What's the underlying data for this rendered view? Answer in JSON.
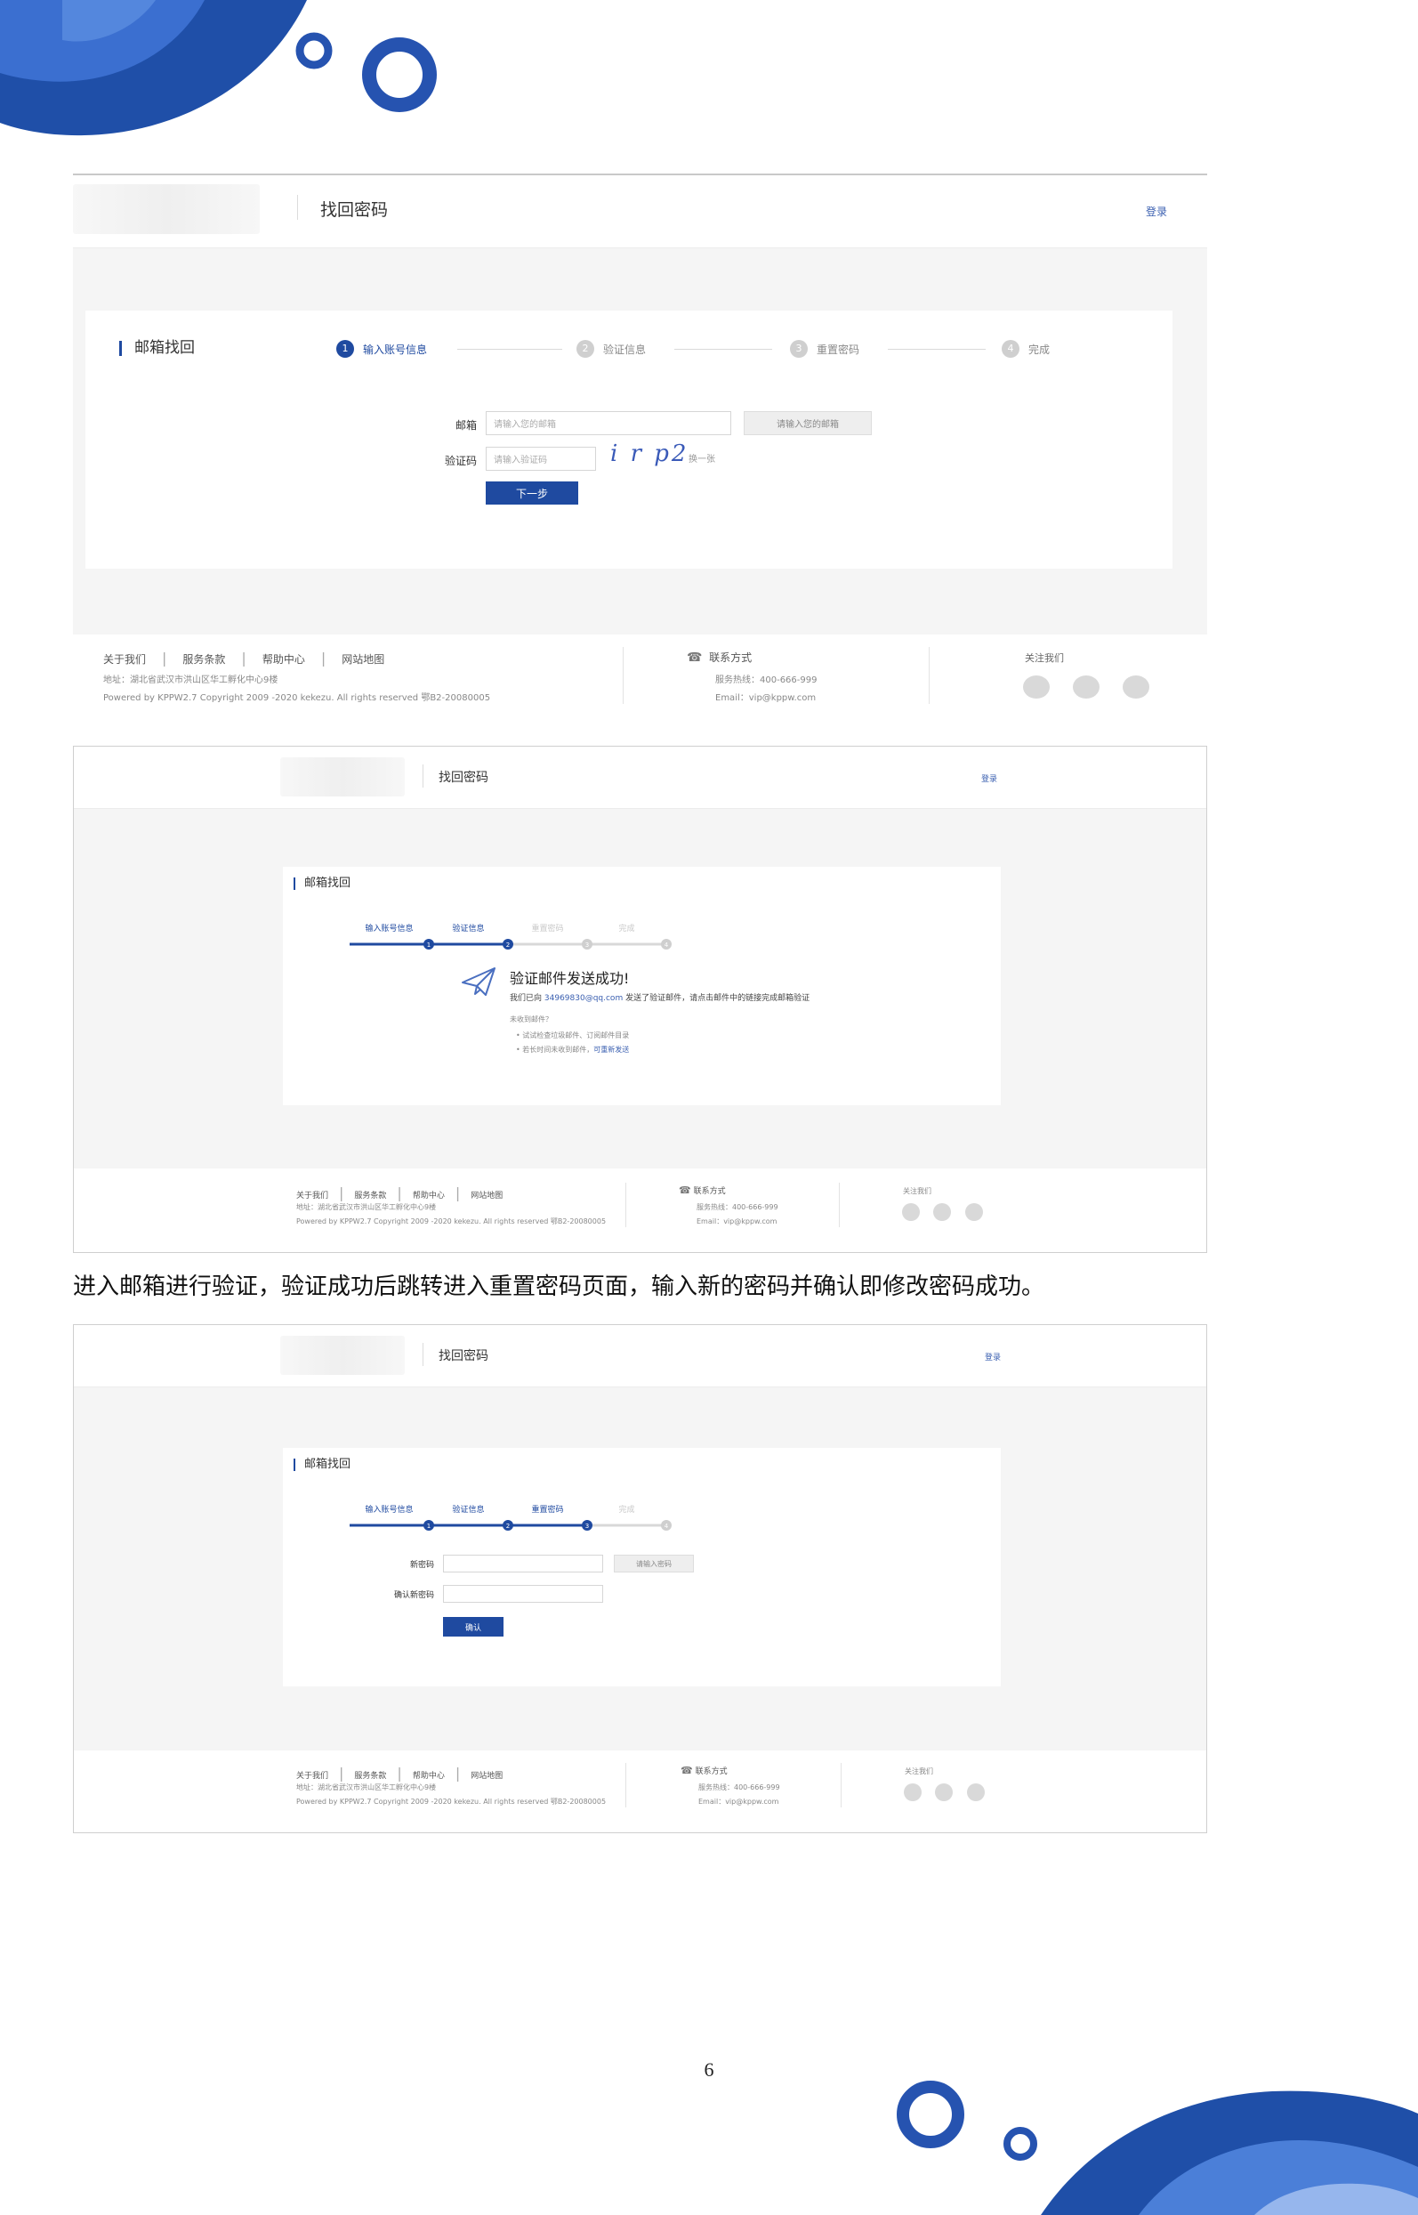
{
  "colors": {
    "brand": "#1f4aa0",
    "link": "#3a5fb0",
    "inactive": "#cfcfcf"
  },
  "shot1": {
    "header": {
      "title": "找回密码",
      "login": "登录"
    },
    "section_title": "邮箱找回",
    "steps": [
      {
        "num": "1",
        "label": "输入账号信息",
        "active": true
      },
      {
        "num": "2",
        "label": "验证信息",
        "active": false
      },
      {
        "num": "3",
        "label": "重置密码",
        "active": false
      },
      {
        "num": "4",
        "label": "完成",
        "active": false
      }
    ],
    "form": {
      "email_label": "邮箱",
      "email_placeholder": "请输入您的邮箱",
      "email_button": "请输入您的邮箱",
      "code_label": "验证码",
      "code_placeholder": "请输入验证码",
      "captcha": "i r p2",
      "refresh": "换一张",
      "next": "下一步"
    },
    "footer": {
      "links": [
        "关于我们",
        "服务条款",
        "帮助中心",
        "网站地图"
      ],
      "address": "地址：湖北省武汉市洪山区华工孵化中心9楼",
      "copyright": "Powered by KPPW2.7 Copyright 2009 -2020 kekezu. All rights reserved 鄂B2-20080005",
      "contact_title": "联系方式",
      "phone": "服务热线：400-666-999",
      "email": "Email：vip@kppw.com",
      "follow": "关注我们"
    }
  },
  "shot2": {
    "header": {
      "title": "找回密码",
      "login": "登录"
    },
    "section_title": "邮箱找回",
    "steps": [
      "输入账号信息",
      "验证信息",
      "重置密码",
      "完成"
    ],
    "step_nums": [
      "1",
      "2",
      "3",
      "4"
    ],
    "done_steps": 2,
    "success": {
      "title": "验证邮件发送成功!",
      "line_prefix": "我们已向",
      "mail": "34969830@qq.com",
      "line_suffix": "发送了验证邮件，请点击邮件中的链接完成邮箱验证",
      "tip_title": "未收到邮件？",
      "tip1": "• 试试检查垃圾邮件、订阅邮件目录",
      "tip2_prefix": "• 若长时间未收到邮件，",
      "tip2_link": "可重新发送"
    },
    "footer": {
      "links": [
        "关于我们",
        "服务条款",
        "帮助中心",
        "网站地图"
      ],
      "address": "地址：湖北省武汉市洪山区华工孵化中心9楼",
      "copyright": "Powered by KPPW2.7 Copyright 2009 -2020 kekezu. All rights reserved 鄂B2-20080005",
      "contact_title": "联系方式",
      "phone": "服务热线：400-666-999",
      "email": "Email：vip@kppw.com",
      "follow": "关注我们"
    }
  },
  "paragraph": "进入邮箱进行验证，验证成功后跳转进入重置密码页面，输入新的密码并确认即修改密码成功。",
  "shot3": {
    "header": {
      "title": "找回密码",
      "login": "登录"
    },
    "section_title": "邮箱找回",
    "steps": [
      "输入账号信息",
      "验证信息",
      "重置密码",
      "完成"
    ],
    "step_nums": [
      "1",
      "2",
      "3",
      "4"
    ],
    "done_steps": 3,
    "form": {
      "new_label": "新密码",
      "new_button": "请输入密码",
      "confirm_label": "确认新密码",
      "submit": "确认"
    },
    "footer": {
      "links": [
        "关于我们",
        "服务条款",
        "帮助中心",
        "网站地图"
      ],
      "address": "地址：湖北省武汉市洪山区华工孵化中心9楼",
      "copyright": "Powered by KPPW2.7 Copyright 2009 -2020 kekezu. All rights reserved 鄂B2-20080005",
      "contact_title": "联系方式",
      "phone": "服务热线：400-666-999",
      "email": "Email：vip@kppw.com",
      "follow": "关注我们"
    }
  },
  "page_number": "6"
}
